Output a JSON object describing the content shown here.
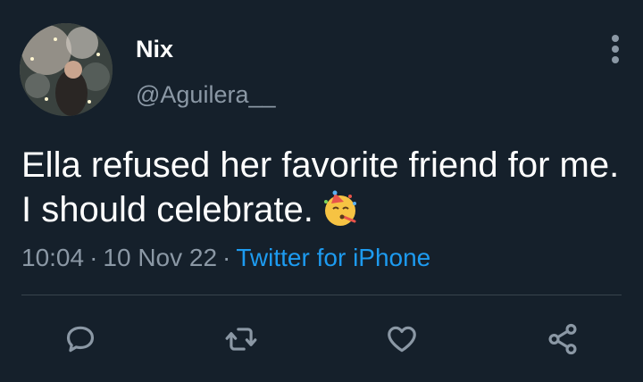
{
  "tweet": {
    "author_name": "Nix",
    "author_handle": "@Aguilera__",
    "text": "Ella refused her favorite friend for me. I should celebrate.",
    "emoji_icon": "partying-face-icon",
    "time": "10:04",
    "date": "10 Nov 22",
    "separator": "·",
    "source": "Twitter for iPhone"
  },
  "actions": {
    "reply_icon": "reply-icon",
    "retweet_icon": "retweet-icon",
    "like_icon": "heart-icon",
    "share_icon": "share-icon"
  },
  "colors": {
    "background": "#15202b",
    "text": "#ffffff",
    "secondary_text": "#8b98a5",
    "link": "#1d9bf0",
    "divider": "#38444d"
  }
}
